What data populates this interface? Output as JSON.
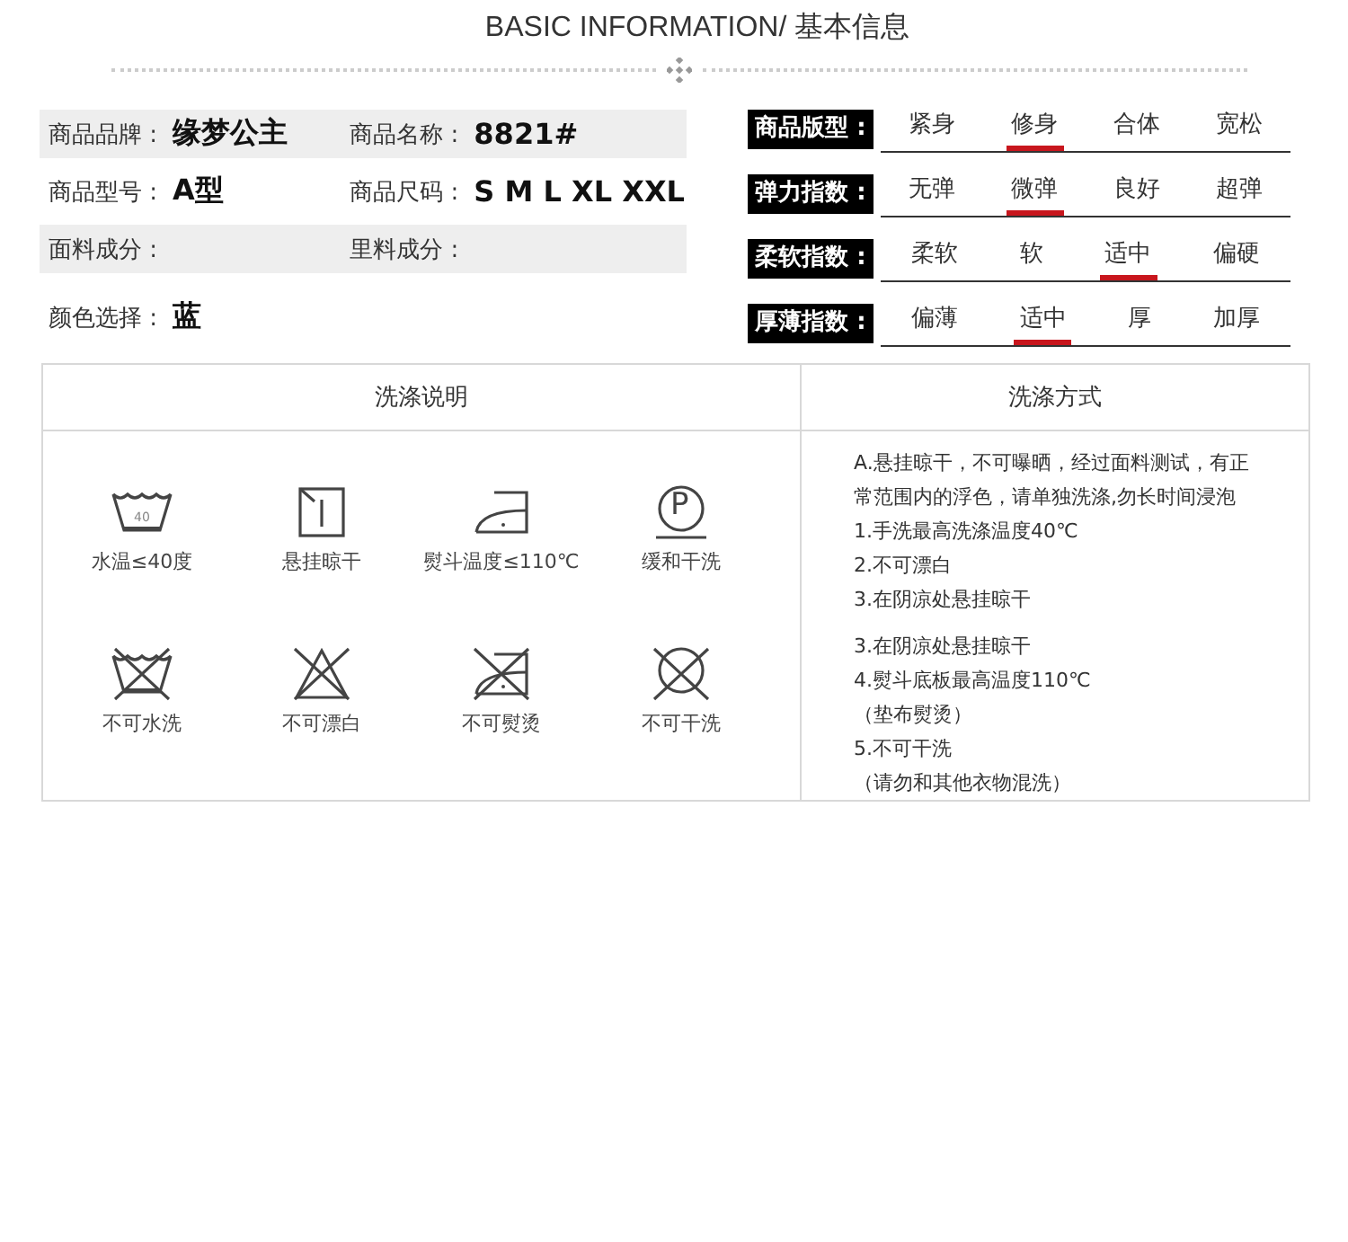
{
  "heading": "BASIC INFORMATION/ 基本信息",
  "info_rows": [
    {
      "shaded": true,
      "pairs": [
        {
          "label": "商品品牌 :",
          "value": "缘梦公主"
        },
        {
          "label": "商品名称 :",
          "value": "8821#"
        }
      ]
    },
    {
      "shaded": false,
      "pairs": [
        {
          "label": "商品型号 :",
          "value": "A型"
        },
        {
          "label": "商品尺码 :",
          "value": "S M L XL XXL"
        }
      ]
    },
    {
      "shaded": true,
      "pairs": [
        {
          "label": "面料成分 :"
        },
        {
          "label": "里料成分 :"
        }
      ]
    },
    {
      "shaded": false,
      "pairs": [
        {
          "label": "颜色选择 :",
          "value": "蓝"
        }
      ]
    }
  ],
  "attributes": [
    {
      "label": "商品版型 :",
      "options": [
        {
          "text": "紧身",
          "selected": false
        },
        {
          "text": "修身",
          "selected": true
        },
        {
          "text": "合体",
          "selected": false
        },
        {
          "text": "宽松",
          "selected": false
        }
      ]
    },
    {
      "label": "弹力指数 :",
      "options": [
        {
          "text": "无弹",
          "selected": false
        },
        {
          "text": "微弹",
          "selected": true
        },
        {
          "text": "良好",
          "selected": false
        },
        {
          "text": "超弹",
          "selected": false
        }
      ]
    },
    {
      "label": "柔软指数 :",
      "options": [
        {
          "text": "柔软",
          "selected": false
        },
        {
          "text": "软",
          "selected": false
        },
        {
          "text": "适中",
          "selected": true
        },
        {
          "text": "偏硬",
          "selected": false
        }
      ]
    },
    {
      "label": "厚薄指数 :",
      "options": [
        {
          "text": "偏薄",
          "selected": false
        },
        {
          "text": "适中",
          "selected": true
        },
        {
          "text": "厚",
          "selected": false
        },
        {
          "text": "加厚",
          "selected": false
        }
      ]
    }
  ],
  "care": {
    "columns": [
      "洗涤说明",
      "洗涤方式"
    ],
    "symbols": [
      {
        "kind": "wash",
        "crossed": false,
        "icon_text": "40",
        "label": "水温≤40度"
      },
      {
        "kind": "hang",
        "crossed": false,
        "label": "悬挂晾干"
      },
      {
        "kind": "iron",
        "crossed": false,
        "label": "熨斗温度≤110℃"
      },
      {
        "kind": "dryclean",
        "crossed": false,
        "icon_text": "P",
        "label": "缓和干洗"
      },
      {
        "kind": "wash",
        "crossed": true,
        "label": "不可水洗"
      },
      {
        "kind": "bleach",
        "crossed": true,
        "label": "不可漂白"
      },
      {
        "kind": "iron",
        "crossed": true,
        "label": "不可熨烫"
      },
      {
        "kind": "dryclean",
        "crossed": true,
        "label": "不可干洗"
      }
    ],
    "instructions": [
      "A.悬挂晾干，不可曝晒，经过面料测试，有正常范围内的浮色，请单独洗涤,勿长时间浸泡",
      "1.手洗最高洗涤温度40℃",
      "2.不可漂白",
      "3.在阴凉处悬挂晾干",
      "3.在阴凉处悬挂晾干",
      "4.熨斗底板最高温度110℃",
      "（垫布熨烫）",
      "5.不可干洗",
      "（请勿和其他衣物混洗）"
    ]
  }
}
